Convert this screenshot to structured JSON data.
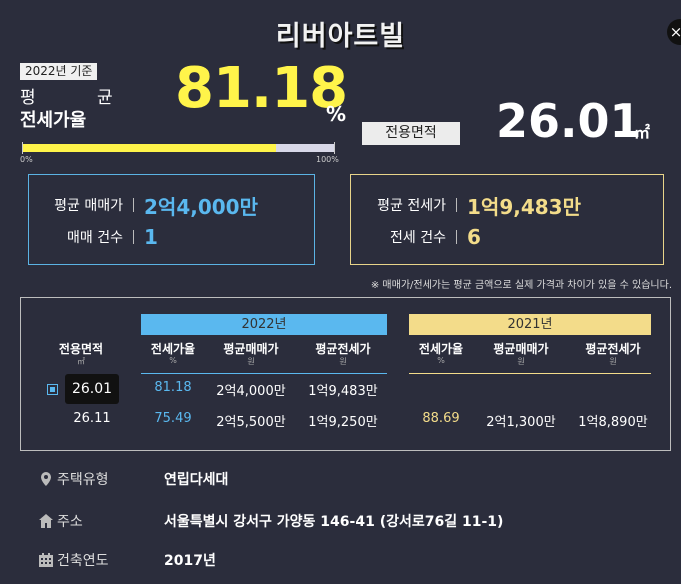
{
  "title": "리버아트빌",
  "close_label": "×",
  "summary": {
    "year_badge": "2022년 기준",
    "avg_label": "평 균",
    "rate_label": "전세가율",
    "rate_value": "81.18",
    "rate_unit": "%",
    "progress_value_percent": 81.18,
    "progress_min": "0%",
    "progress_max": "100%",
    "area_label": "전용면적",
    "area_value": "26.01",
    "area_unit": "㎡"
  },
  "sale_box": {
    "price_label": "평균 매매가",
    "price_value": "2억4,000만",
    "count_label": "매매 건수",
    "count_value": "1"
  },
  "jeonse_box": {
    "price_label": "평균 전세가",
    "price_value": "1억9,483만",
    "count_label": "전세 건수",
    "count_value": "6"
  },
  "note": "※ 매매가/전세가는 평균 금액으로 실제 가격과 차이가 있을 수 있습니다.",
  "table": {
    "area_header": "전용면적",
    "area_unit": "㎡",
    "year_2022": "2022년",
    "year_2021": "2021년",
    "col_rate": "전세가율",
    "col_rate_unit": "%",
    "col_sale": "평균매매가",
    "col_sale_unit": "원",
    "col_jeonse": "평균전세가",
    "col_jeonse_unit": "원",
    "rows": [
      {
        "area": "26.01",
        "y2022_rate": "81.18",
        "y2022_sale": "2억4,000만",
        "y2022_jeonse": "1억9,483만",
        "y2021_rate": "",
        "y2021_sale": "",
        "y2021_jeonse": ""
      },
      {
        "area": "26.11",
        "y2022_rate": "75.49",
        "y2022_sale": "2억5,500만",
        "y2022_jeonse": "1억9,250만",
        "y2021_rate": "88.69",
        "y2021_sale": "2억1,300만",
        "y2021_jeonse": "1억8,890만"
      }
    ]
  },
  "info": {
    "type_label": "주택유형",
    "type_value": "연립다세대",
    "address_label": "주소",
    "address_value": "서울특별시 강서구 가양동 146-41 (강서로76길 11-1)",
    "year_label": "건축연도",
    "year_value": "2017년"
  },
  "colors": {
    "background": "#2b2d3c",
    "accent_yellow": "#fff44a",
    "blue_2022": "#5ab8ef",
    "yellow_2021": "#f3dc8a"
  }
}
